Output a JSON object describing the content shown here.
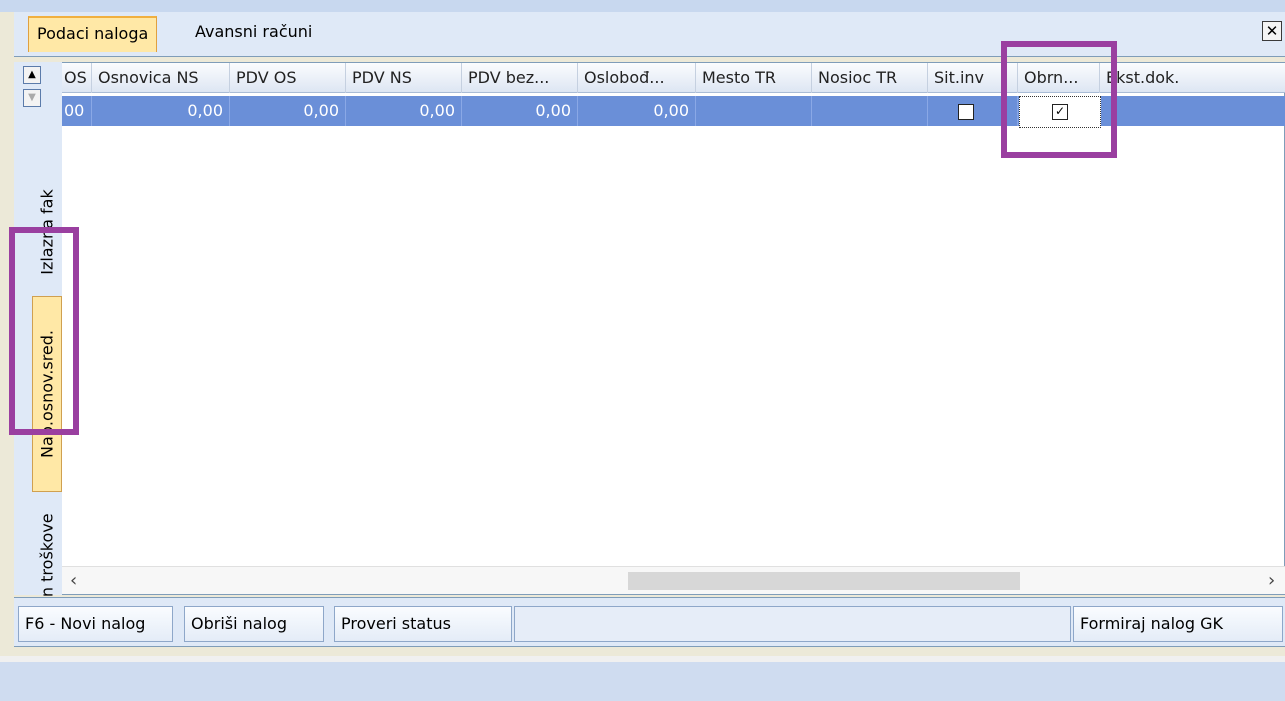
{
  "tabs": [
    {
      "label": "Podaci naloga",
      "active": true
    },
    {
      "label": "Avansni računi",
      "active": false
    }
  ],
  "close_label": "✕",
  "side_tabs": [
    {
      "label": "Izlazna fak"
    },
    {
      "label": "Nab.osnov.sred.",
      "active": true
    },
    {
      "label": "Račun troškove"
    }
  ],
  "grid": {
    "columns": [
      "OS",
      "Osnovica NS",
      "PDV OS",
      "PDV NS",
      "PDV bez...",
      "Oslobođ...",
      "Mesto TR",
      "Nosioc TR",
      "Sit.inv",
      "Obrn...",
      "Ekst.dok."
    ],
    "row": {
      "c0": "00",
      "c1": "0,00",
      "c2": "0,00",
      "c3": "0,00",
      "c4": "0,00",
      "c5": "0,00",
      "c6": "",
      "c7": "",
      "sit_inv": false,
      "obrn": true,
      "ekst": ""
    }
  },
  "buttons": {
    "novi": "F6 - Novi nalog",
    "obrisi": "Obriši nalog",
    "proveri": "Proveri status",
    "formiraj": "Formiraj nalog GK"
  },
  "colors": {
    "highlight": "#9a3fa0",
    "selected_row": "#6a8fd8",
    "active_tab": "#ffe8a6"
  }
}
